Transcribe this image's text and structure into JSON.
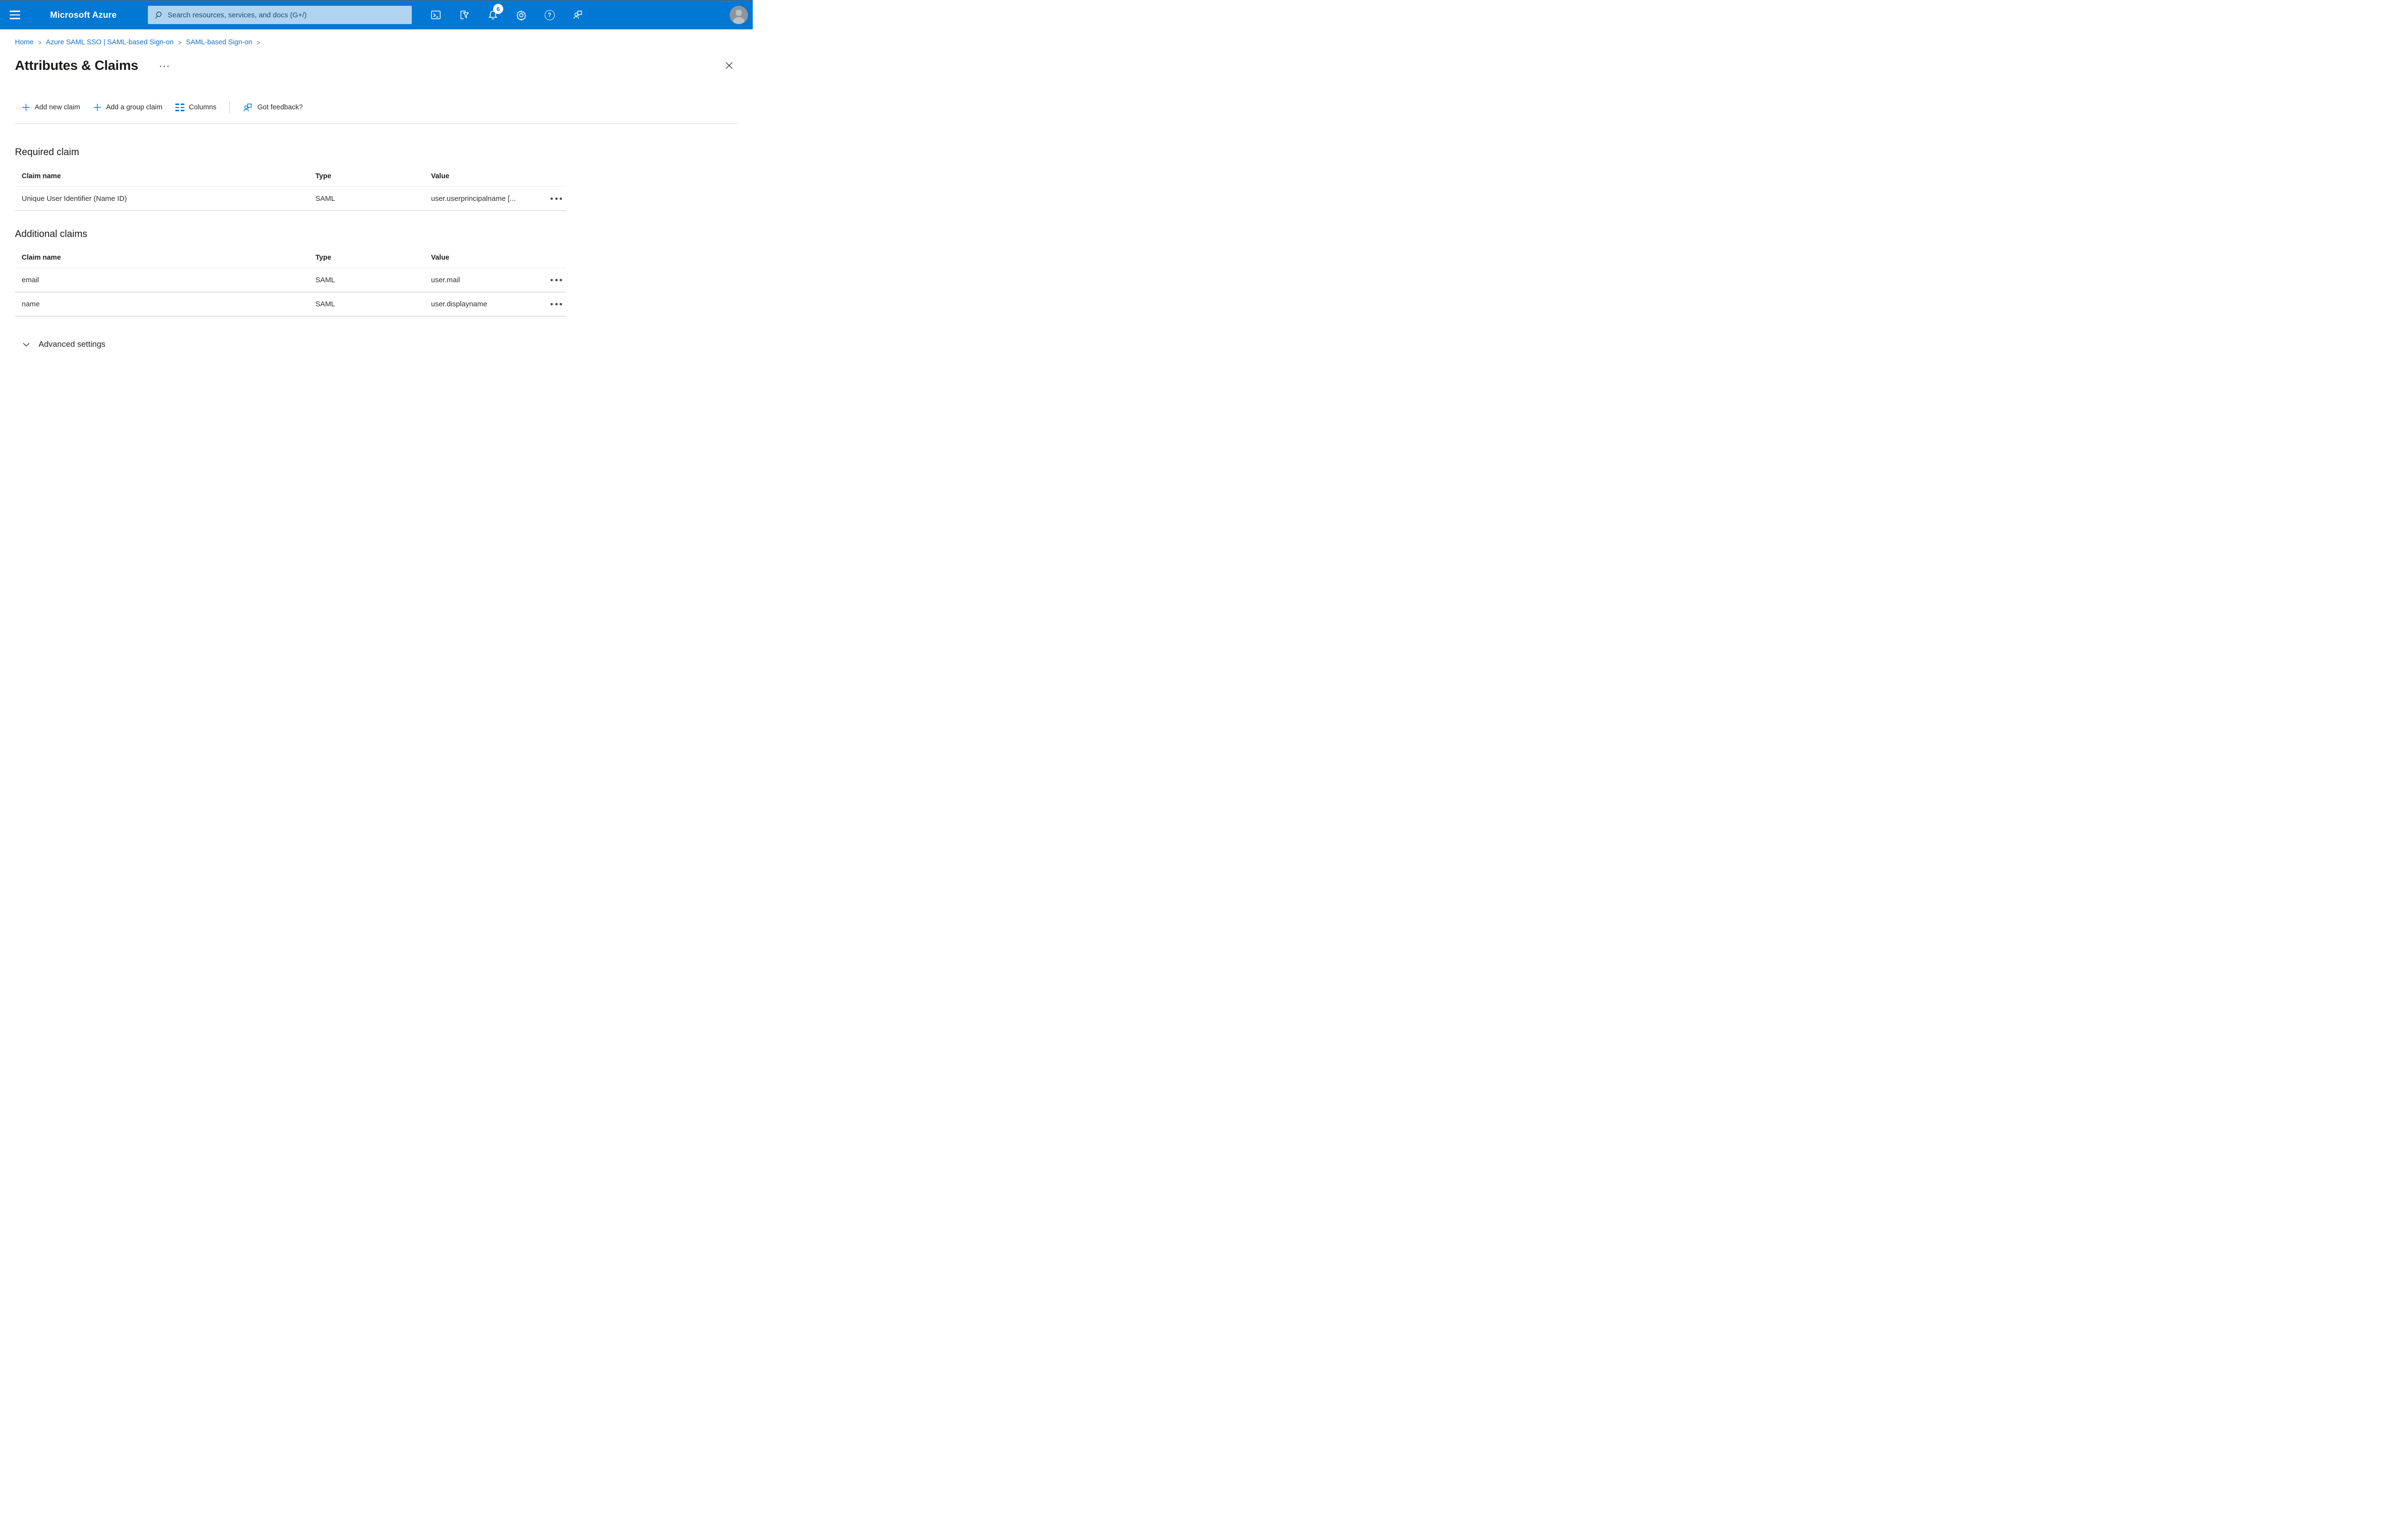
{
  "topbar": {
    "brand": "Microsoft Azure",
    "search_placeholder": "Search resources, services, and docs (G+/)",
    "notification_count": "6",
    "icons": [
      "hamburger-icon",
      "search-icon",
      "cloud-shell-icon",
      "directory-filter-icon",
      "bell-icon",
      "gear-icon",
      "help-icon",
      "feedback-icon",
      "avatar"
    ]
  },
  "breadcrumb": {
    "items": [
      "Home",
      "Azure SAML SSO | SAML-based Sign-on",
      "SAML-based Sign-on"
    ]
  },
  "page": {
    "title": "Attributes & Claims",
    "more_label": "...",
    "close_icon": "close-icon"
  },
  "toolbar": {
    "add_new_claim": "Add new claim",
    "add_group_claim": "Add a group claim",
    "columns": "Columns",
    "got_feedback": "Got feedback?"
  },
  "required": {
    "heading": "Required claim",
    "columns": [
      "Claim name",
      "Type",
      "Value"
    ],
    "rows": [
      {
        "name": "Unique User Identifier (Name ID)",
        "type": "SAML",
        "value": "user.userprincipalname [..."
      }
    ]
  },
  "additional": {
    "heading": "Additional claims",
    "columns": [
      "Claim name",
      "Type",
      "Value"
    ],
    "rows": [
      {
        "name": "email",
        "type": "SAML",
        "value": "user.mail"
      },
      {
        "name": "name",
        "type": "SAML",
        "value": "user.displayname"
      }
    ]
  },
  "advanced": {
    "label": "Advanced settings"
  },
  "colors": {
    "topbar_bg": "#0078d4",
    "accent_blue": "#0078d4",
    "link_blue": "#1673d2",
    "search_bg": "#b0d3ef",
    "search_text": "#1d4e74",
    "badge_bg": "#ffffff",
    "badge_text": "#0078d4",
    "header_border": "#edebe9",
    "row_border": "#c6c6c6",
    "title_text": "#1b1a19"
  }
}
